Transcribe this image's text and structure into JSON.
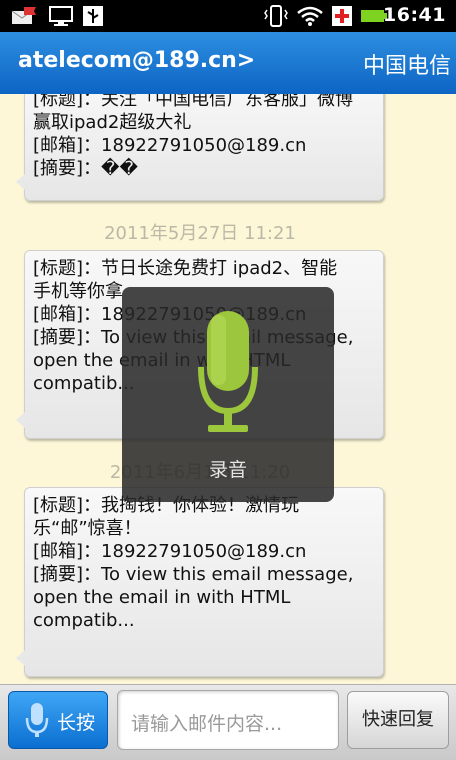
{
  "status_bar": {
    "time": "16:41",
    "icons": [
      "email-flag-icon",
      "monitor-icon",
      "usb-icon",
      "vibrate-icon",
      "wifi-icon",
      "red-cross-icon",
      "battery-icon"
    ]
  },
  "header": {
    "title": "atelecom@189.cn>",
    "right_text": "中国电信"
  },
  "messages": [
    {
      "lines": [
        "[标题]：关注「中国电信广东客服」微博",
        "赢取ipad2超级大礼",
        "[邮箱]：18922791050@189.cn",
        "[摘要]：��"
      ]
    },
    {
      "timestamp": "2011年5月27日 11:21",
      "lines": [
        "[标题]：节日长途免费打 ipad2、智能",
        "手机等你拿",
        "[邮箱]：18922791050@189.cn",
        "[摘要]：To view this email message,",
        "open the email in with HTML",
        "compatib..."
      ]
    },
    {
      "timestamp": "2011年6月1日 11:20",
      "lines": [
        "[标题]：我掏钱！你体验！激情玩",
        "乐“邮”惊喜！",
        "[邮箱]：18922791050@189.cn",
        "[摘要]：To view this email message,",
        "open the email in with HTML",
        "compatib..."
      ]
    }
  ],
  "overlay": {
    "label": "录音",
    "icon": "microphone-icon"
  },
  "bottom_bar": {
    "hold_button_label": "长按",
    "input_placeholder": "请输入邮件内容...",
    "quick_reply_label": "快速回复"
  },
  "colors": {
    "title_bar": "#1a78d6",
    "background": "#fdf7d8",
    "mic_green": "#9cc63c"
  }
}
